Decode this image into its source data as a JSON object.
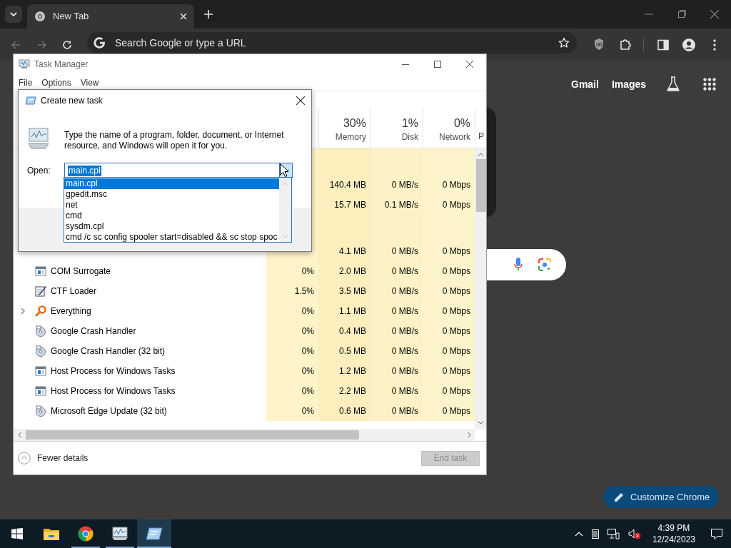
{
  "browser": {
    "tabs": [
      {
        "title": "New Tab",
        "selected": true
      }
    ],
    "omnibox": {
      "placeholder": "Search Google or type a URL"
    },
    "links": [
      "Gmail",
      "Images"
    ],
    "customize_button": "Customize Chrome"
  },
  "task_manager": {
    "window_title": "Task Manager",
    "menu": [
      "File",
      "Options",
      "View"
    ],
    "columns": [
      {
        "kind": "usage",
        "percent": "30%",
        "label": "Memory"
      },
      {
        "kind": "usage",
        "percent": "1%",
        "label": "Disk"
      },
      {
        "kind": "usage",
        "percent": "0%",
        "label": "Network"
      },
      {
        "kind": "cut",
        "label": "P"
      }
    ],
    "rows": [
      {
        "kind": "group"
      },
      {
        "kind": "covered",
        "memory": "140.4 MB",
        "disk": "0 MB/s",
        "network": "0 Mbps"
      },
      {
        "kind": "covered",
        "memory": "15.7 MB",
        "disk": "0.1 MB/s",
        "network": "0 Mbps"
      },
      {
        "kind": "group"
      },
      {
        "kind": "covered",
        "memory": "4.1 MB",
        "disk": "0 MB/s",
        "network": "0 Mbps"
      },
      {
        "kind": "window",
        "name": "COM Surrogate",
        "expandable": false,
        "cpu": "0%",
        "memory": "2.0 MB",
        "disk": "0 MB/s",
        "network": "0 Mbps"
      },
      {
        "kind": "pen",
        "name": "CTF Loader",
        "expandable": false,
        "cpu": "1.5%",
        "memory": "3.5 MB",
        "disk": "0 MB/s",
        "network": "0 Mbps"
      },
      {
        "kind": "magnifier",
        "name": "Everything",
        "expandable": true,
        "cpu": "0%",
        "memory": "1.1 MB",
        "disk": "0 MB/s",
        "network": "0 Mbps"
      },
      {
        "kind": "disc",
        "name": "Google Crash Handler",
        "expandable": false,
        "cpu": "0%",
        "memory": "0.4 MB",
        "disk": "0 MB/s",
        "network": "0 Mbps"
      },
      {
        "kind": "disc",
        "name": "Google Crash Handler (32 bit)",
        "expandable": false,
        "cpu": "0%",
        "memory": "0.5 MB",
        "disk": "0 MB/s",
        "network": "0 Mbps"
      },
      {
        "kind": "window",
        "name": "Host Process for Windows Tasks",
        "expandable": false,
        "cpu": "0%",
        "memory": "1.2 MB",
        "disk": "0 MB/s",
        "network": "0 Mbps"
      },
      {
        "kind": "window",
        "name": "Host Process for Windows Tasks",
        "expandable": false,
        "cpu": "0%",
        "memory": "2.2 MB",
        "disk": "0 MB/s",
        "network": "0 Mbps"
      },
      {
        "kind": "disc",
        "name": "Microsoft Edge Update (32 bit)",
        "expandable": false,
        "cpu": "0%",
        "memory": "0.6 MB",
        "disk": "0 MB/s",
        "network": "0 Mbps"
      }
    ],
    "fewer_details": "Fewer details",
    "end_task": {
      "label": "End task",
      "disabled": true
    }
  },
  "dialog": {
    "title": "Create new task",
    "message": "Type the name of a program, folder, document, or Internet resource, and Windows will open it for you.",
    "open_label": "Open:",
    "value": "main.cpl",
    "history": [
      {
        "text": "main.cpl",
        "selected": true
      },
      {
        "text": "gpedit.msc",
        "selected": false
      },
      {
        "text": "net",
        "selected": false
      },
      {
        "text": "cmd",
        "selected": false
      },
      {
        "text": "sysdm.cpl",
        "selected": false
      },
      {
        "text": "cmd /c sc config spooler start=disabled && sc stop spoc",
        "selected": false
      }
    ]
  },
  "taskbar": {
    "apps": [
      {
        "kind": "explorer",
        "running": false,
        "active": false
      },
      {
        "kind": "chrome",
        "running": true,
        "active": false
      },
      {
        "kind": "taskmgr",
        "running": true,
        "active": false
      },
      {
        "kind": "run",
        "running": true,
        "active": true
      }
    ],
    "time": "4:39 PM",
    "date": "12/24/2023"
  }
}
